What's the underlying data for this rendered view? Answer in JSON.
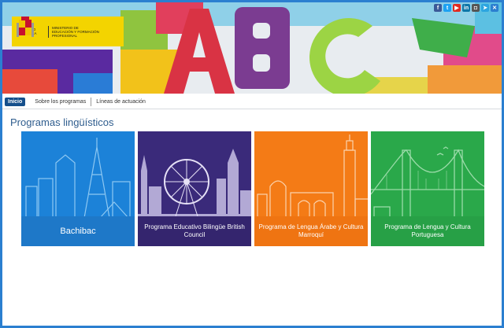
{
  "logo": {
    "left_text": "GOBIERNO DE ESPAÑA",
    "right_text": "MINISTERIO DE EDUCACIÓN Y FORMACIÓN PROFESIONAL"
  },
  "social": [
    {
      "name": "facebook-icon",
      "glyph": "f",
      "color": "#3b5998"
    },
    {
      "name": "twitter-icon",
      "glyph": "t",
      "color": "#1da1f2"
    },
    {
      "name": "youtube-icon",
      "glyph": "▶",
      "color": "#e02a20"
    },
    {
      "name": "linkedin-icon",
      "glyph": "in",
      "color": "#0e76a8"
    },
    {
      "name": "instagram-icon",
      "glyph": "◘",
      "color": "#555555"
    },
    {
      "name": "telegram-icon",
      "glyph": "➤",
      "color": "#2ca5e0"
    },
    {
      "name": "extra-icon",
      "glyph": "✕",
      "color": "#2b7fd0"
    }
  ],
  "nav": {
    "items": [
      "Inicio",
      "Sobre los programas",
      "Líneas de actuación"
    ]
  },
  "page": {
    "title": "Programas lingüísticos"
  },
  "cards": [
    {
      "label": "Bachibac",
      "color": "#1c82d8",
      "label_bg": "#1e78c8"
    },
    {
      "label": "Programa Educativo Bilingüe British Council",
      "color": "#3a2a7a",
      "label_bg": "#34256e"
    },
    {
      "label": "Programa de Lengua Árabe y Cultura Marroquí",
      "color": "#f47b16",
      "label_bg": "#ef7412"
    },
    {
      "label": "Programa de Lengua y Cultura Portuguesa",
      "color": "#2aa84a",
      "label_bg": "#27a046"
    }
  ]
}
